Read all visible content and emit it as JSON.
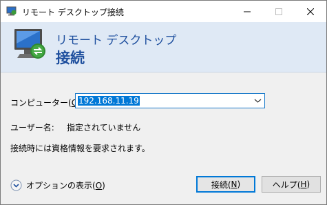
{
  "window": {
    "title": "リモート デスクトップ接続",
    "controls": {
      "minimize": "minimize",
      "maximize": "maximize",
      "close": "close"
    }
  },
  "banner": {
    "line1": "リモート デスクトップ",
    "line2": "接続"
  },
  "form": {
    "computer_label_pre": "コンピューター(",
    "computer_label_key": "C",
    "computer_label_post": "):",
    "computer_value": "192.168.11.19",
    "user_label": "ユーザー名:",
    "user_value": "指定されていません",
    "info": "接続時には資格情報を要求されます。"
  },
  "footer": {
    "options_pre": "オプションの表示(",
    "options_key": "O",
    "options_post": ")",
    "connect_pre": "接続(",
    "connect_key": "N",
    "connect_post": ")",
    "help_pre": "ヘルプ(",
    "help_key": "H",
    "help_post": ")"
  },
  "colors": {
    "accent": "#0078d7",
    "banner_bg": "#dfe9f5",
    "banner_text": "#1e4f9e"
  }
}
